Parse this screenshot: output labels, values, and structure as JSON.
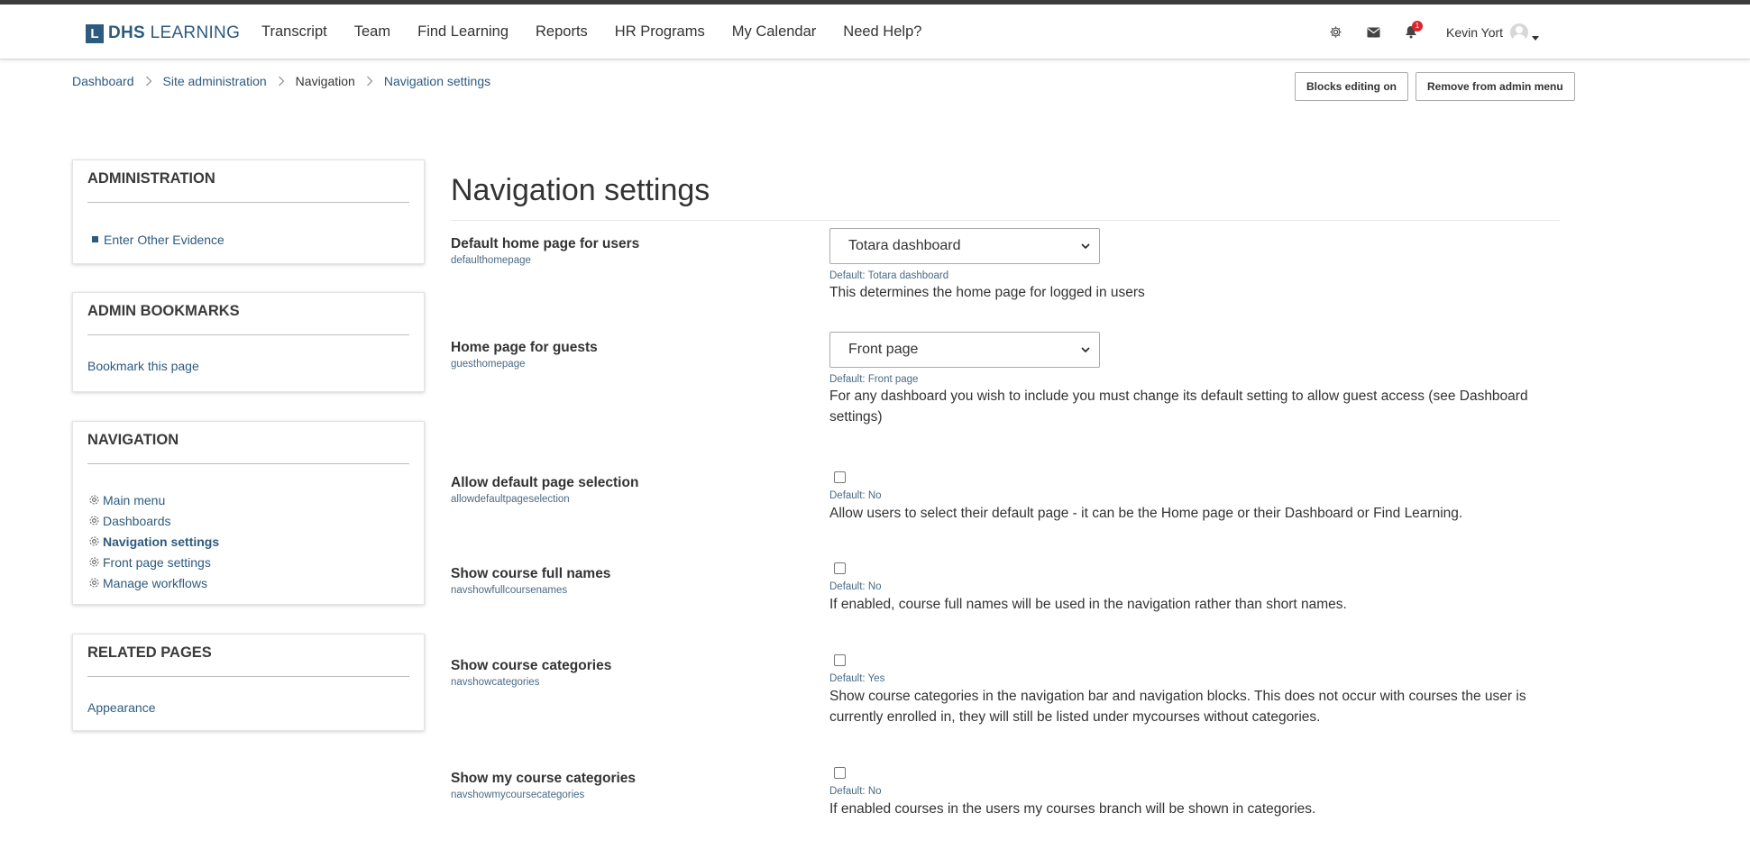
{
  "header": {
    "logo_letter": "L",
    "logo_bold": "DHS",
    "logo_light": "LEARNING",
    "nav": [
      "Transcript",
      "Team",
      "Find Learning",
      "Reports",
      "HR Programs",
      "My Calendar",
      "Need Help?"
    ],
    "notification_count": "1",
    "user_name": "Kevin Yort"
  },
  "breadcrumb": {
    "items": [
      "Dashboard",
      "Site administration",
      "Navigation",
      "Navigation settings"
    ]
  },
  "actions": {
    "blocks_editing": "Blocks editing on",
    "remove_admin": "Remove from admin menu"
  },
  "sidebar": {
    "administration": {
      "title": "ADMINISTRATION",
      "items": [
        "Enter Other Evidence"
      ]
    },
    "bookmarks": {
      "title": "ADMIN BOOKMARKS",
      "items": [
        "Bookmark this page"
      ]
    },
    "navigation": {
      "title": "NAVIGATION",
      "items": [
        "Main menu",
        "Dashboards",
        "Navigation settings",
        "Front page settings",
        "Manage workflows"
      ],
      "active_index": 2
    },
    "related": {
      "title": "RELATED PAGES",
      "items": [
        "Appearance"
      ]
    }
  },
  "main": {
    "title": "Navigation settings",
    "settings": [
      {
        "label": "Default home page for users",
        "key": "defaulthomepage",
        "type": "select",
        "value": "Totara dashboard",
        "default": "Default: Totara dashboard",
        "description": "This determines the home page for logged in users"
      },
      {
        "label": "Home page for guests",
        "key": "guesthomepage",
        "type": "select",
        "value": "Front page",
        "default": "Default: Front page",
        "description": "For any dashboard you wish to include you must change its default setting to allow guest access (see Dashboard settings)"
      },
      {
        "label": "Allow default page selection",
        "key": "allowdefaultpageselection",
        "type": "checkbox",
        "checked": false,
        "default": "Default: No",
        "description": "Allow users to select their default page - it can be the Home page or their Dashboard or Find Learning."
      },
      {
        "label": "Show course full names",
        "key": "navshowfullcoursenames",
        "type": "checkbox",
        "checked": false,
        "default": "Default: No",
        "description": "If enabled, course full names will be used in the navigation rather than short names."
      },
      {
        "label": "Show course categories",
        "key": "navshowcategories",
        "type": "checkbox",
        "checked": false,
        "default": "Default: Yes",
        "description": "Show course categories in the navigation bar and navigation blocks. This does not occur with courses the user is currently enrolled in, they will still be listed under mycourses without categories."
      },
      {
        "label": "Show my course categories",
        "key": "navshowmycoursecategories",
        "type": "checkbox",
        "checked": false,
        "default": "Default: No",
        "description": "If enabled courses in the users my courses branch will be shown in categories."
      }
    ]
  },
  "colors": {
    "brand": "#2d5a7f",
    "badge": "#d9262c",
    "topstrip": "#3c3c3c"
  }
}
